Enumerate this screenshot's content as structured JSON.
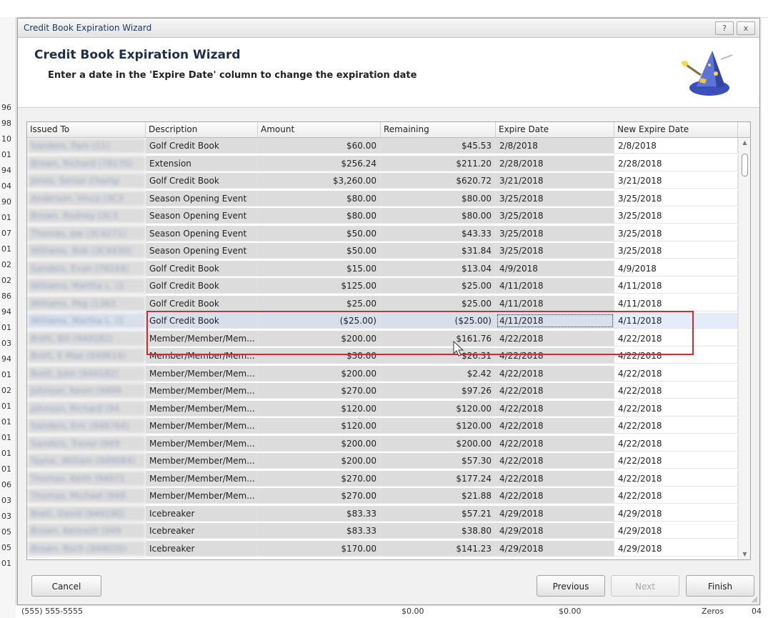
{
  "background": {
    "row_labels": [
      "96",
      "98",
      "10",
      "01",
      "94",
      "04",
      "90",
      "01",
      "07",
      "01",
      "02",
      "02",
      "86",
      "94",
      "01",
      "03",
      "94",
      "01",
      "02",
      "01",
      "01",
      "01",
      "01",
      "01",
      "06",
      "03",
      "03",
      "05",
      "05",
      "01"
    ],
    "status_line": {
      "phone": "(555) 555-5555",
      "amount1": "$0.00",
      "amount2": "$0.00",
      "tail": "Zeros",
      "last": "04"
    }
  },
  "dialog": {
    "window_title": "Credit Book Expiration Wizard",
    "help_button": "?",
    "close_button": "x",
    "heading": "Credit Book Expiration Wizard",
    "subtitle": "Enter a date in the 'Expire Date' column to change the expiration date",
    "icon": "wizard-hat-icon"
  },
  "grid": {
    "columns": [
      "Issued To",
      "Description",
      "Amount",
      "Remaining",
      "Expire Date",
      "New Expire Date"
    ],
    "rows": [
      {
        "issued_to": "Sanders, Pam (11)",
        "description": "Golf Credit Book",
        "amount": "$60.00",
        "remaining": "$45.53",
        "expire": "2/8/2018",
        "new_expire": "2/8/2018"
      },
      {
        "issued_to": "Brown, Richard (78170)",
        "description": "Extension",
        "amount": "$256.24",
        "remaining": "$211.20",
        "expire": "2/28/2018",
        "new_expire": "2/28/2018"
      },
      {
        "issued_to": "Jones, Senior Champ",
        "description": "Golf Credit Book",
        "amount": "$3,260.00",
        "remaining": "$620.72",
        "expire": "3/21/2018",
        "new_expire": "3/21/2018"
      },
      {
        "issued_to": "Anderson, Vince (3C3",
        "description": "Season Opening Event",
        "amount": "$80.00",
        "remaining": "$80.00",
        "expire": "3/25/2018",
        "new_expire": "3/25/2018"
      },
      {
        "issued_to": "Brown, Rodney (3C3",
        "description": "Season Opening Event",
        "amount": "$80.00",
        "remaining": "$80.00",
        "expire": "3/25/2018",
        "new_expire": "3/25/2018"
      },
      {
        "issued_to": "Thomas, Joe (3C4271)",
        "description": "Season Opening Event",
        "amount": "$50.00",
        "remaining": "$43.33",
        "expire": "3/25/2018",
        "new_expire": "3/25/2018"
      },
      {
        "issued_to": "Williams, Bob (3C4430)",
        "description": "Season Opening Event",
        "amount": "$50.00",
        "remaining": "$31.84",
        "expire": "3/25/2018",
        "new_expire": "3/25/2018"
      },
      {
        "issued_to": "Sanders, Evan (78169)",
        "description": "Golf Credit Book",
        "amount": "$15.00",
        "remaining": "$13.04",
        "expire": "4/9/2018",
        "new_expire": "4/9/2018"
      },
      {
        "issued_to": "Williams, Martha L. (1",
        "description": "Golf Credit Book",
        "amount": "$125.00",
        "remaining": "$25.00",
        "expire": "4/11/2018",
        "new_expire": "4/11/2018"
      },
      {
        "issued_to": "Williams, Peg (1363",
        "description": "Golf Credit Book",
        "amount": "$25.00",
        "remaining": "$25.00",
        "expire": "4/11/2018",
        "new_expire": "4/11/2018"
      },
      {
        "issued_to": "Williams, Martha L. (1",
        "description": "Golf Credit Book",
        "amount": "($25.00)",
        "remaining": "($25.00)",
        "expire": "4/11/2018",
        "new_expire": "4/11/2018"
      },
      {
        "issued_to": "Brett, Bill (949182)",
        "description": "Member/Member/Mem...",
        "amount": "$200.00",
        "remaining": "$161.76",
        "expire": "4/22/2018",
        "new_expire": "4/22/2018"
      },
      {
        "issued_to": "Brett, E Mae (949614)",
        "description": "Member/Member/Mem...",
        "amount": "$30.00",
        "remaining": "$26.31",
        "expire": "4/22/2018",
        "new_expire": "4/22/2018"
      },
      {
        "issued_to": "Brett, John (949182)",
        "description": "Member/Member/Mem...",
        "amount": "$200.00",
        "remaining": "$2.42",
        "expire": "4/22/2018",
        "new_expire": "4/22/2018"
      },
      {
        "issued_to": "Johnson, Kevin (9499",
        "description": "Member/Member/Mem...",
        "amount": "$270.00",
        "remaining": "$97.26",
        "expire": "4/22/2018",
        "new_expire": "4/22/2018"
      },
      {
        "issued_to": "Johnson, Richard (94",
        "description": "Member/Member/Mem...",
        "amount": "$120.00",
        "remaining": "$120.00",
        "expire": "4/22/2018",
        "new_expire": "4/22/2018"
      },
      {
        "issued_to": "Sanders, Eric (948764)",
        "description": "Member/Member/Mem...",
        "amount": "$120.00",
        "remaining": "$120.00",
        "expire": "4/22/2018",
        "new_expire": "4/22/2018"
      },
      {
        "issued_to": "Sanders, Trevor (949",
        "description": "Member/Member/Mem...",
        "amount": "$200.00",
        "remaining": "$200.00",
        "expire": "4/22/2018",
        "new_expire": "4/22/2018"
      },
      {
        "issued_to": "Taylor, William (949084)",
        "description": "Member/Member/Mem...",
        "amount": "$200.00",
        "remaining": "$57.30",
        "expire": "4/22/2018",
        "new_expire": "4/22/2018"
      },
      {
        "issued_to": "Thomas, Keith (94971",
        "description": "Member/Member/Mem...",
        "amount": "$270.00",
        "remaining": "$177.24",
        "expire": "4/22/2018",
        "new_expire": "4/22/2018"
      },
      {
        "issued_to": "Thomas, Michael (949",
        "description": "Member/Member/Mem...",
        "amount": "$270.00",
        "remaining": "$21.88",
        "expire": "4/22/2018",
        "new_expire": "4/22/2018"
      },
      {
        "issued_to": "Brett, David (949190)",
        "description": "Icebreaker",
        "amount": "$83.33",
        "remaining": "$57.21",
        "expire": "4/29/2018",
        "new_expire": "4/29/2018"
      },
      {
        "issued_to": "Brown, Kenneth (949",
        "description": "Icebreaker",
        "amount": "$83.33",
        "remaining": "$38.80",
        "expire": "4/29/2018",
        "new_expire": "4/29/2018"
      },
      {
        "issued_to": "Brown, Roch (949020)",
        "description": "Icebreaker",
        "amount": "$170.00",
        "remaining": "$141.23",
        "expire": "4/29/2018",
        "new_expire": "4/29/2018"
      }
    ]
  },
  "footer": {
    "cancel_label": "Cancel",
    "previous_label": "Previous",
    "next_label": "Next",
    "finish_label": "Finish"
  },
  "colors": {
    "readonly_cell": "#dcdcdc",
    "highlight_box": "#e0262f",
    "selected_row": "#e4ecf9"
  }
}
